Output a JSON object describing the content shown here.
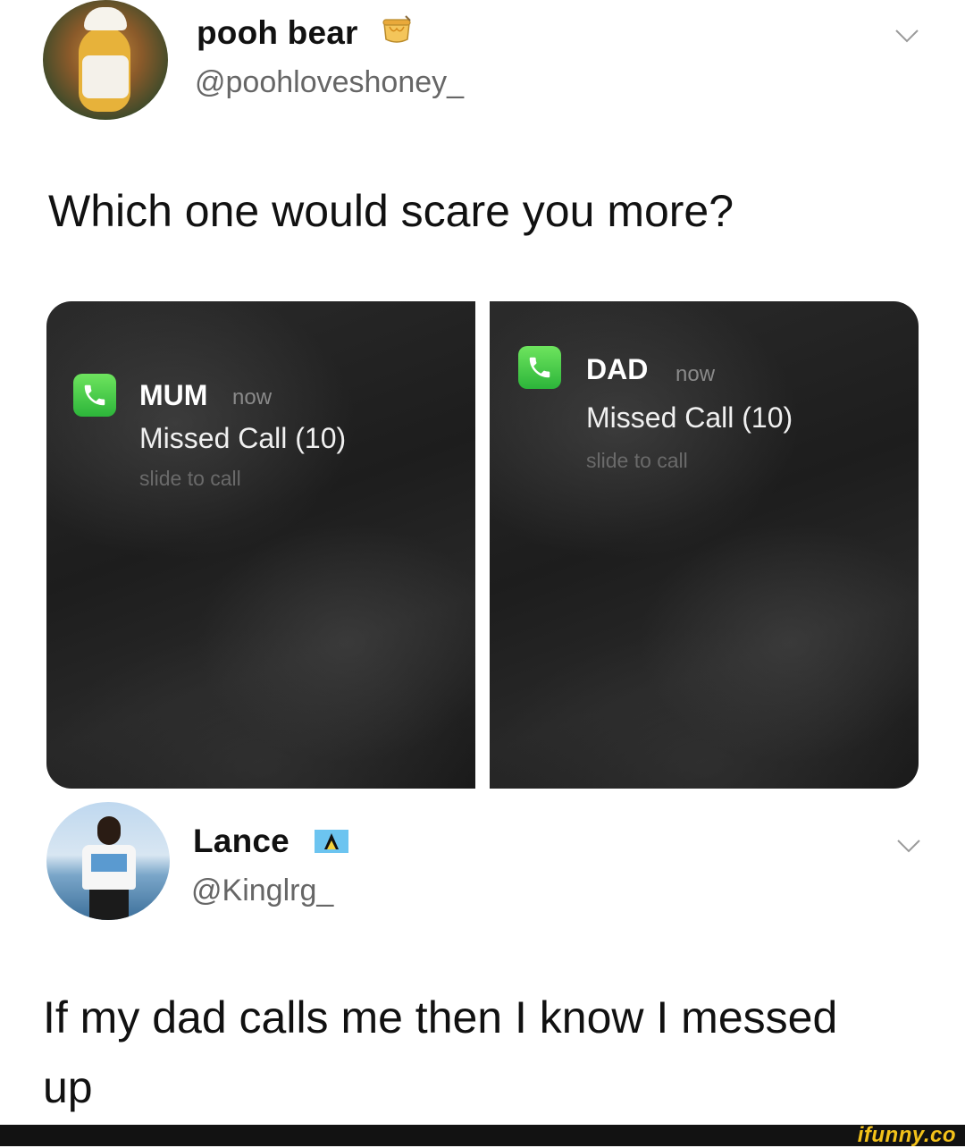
{
  "tweet1": {
    "display_name": "pooh bear",
    "handle": "@poohloveshoney_",
    "text": "Which one would scare you more?",
    "badge_icon": "honey-pot-icon"
  },
  "notifications": {
    "left": {
      "caller": "MUM",
      "time": "now",
      "status": "Missed Call (10)",
      "action": "slide to call"
    },
    "right": {
      "caller": "DAD",
      "time": "now",
      "status": "Missed Call (10)",
      "action": "slide to call"
    }
  },
  "tweet2": {
    "display_name": "Lance",
    "handle": "@Kinglrg_",
    "text_line1": "If my dad calls me then I know I messed",
    "text_line2": "up",
    "badge_icon": "saint-lucia-flag-icon"
  },
  "footer": {
    "watermark": "ifunny.co"
  },
  "colors": {
    "phone_green": "#3cc649",
    "panel_dark": "#222222",
    "watermark_yellow": "#f3c21a"
  }
}
